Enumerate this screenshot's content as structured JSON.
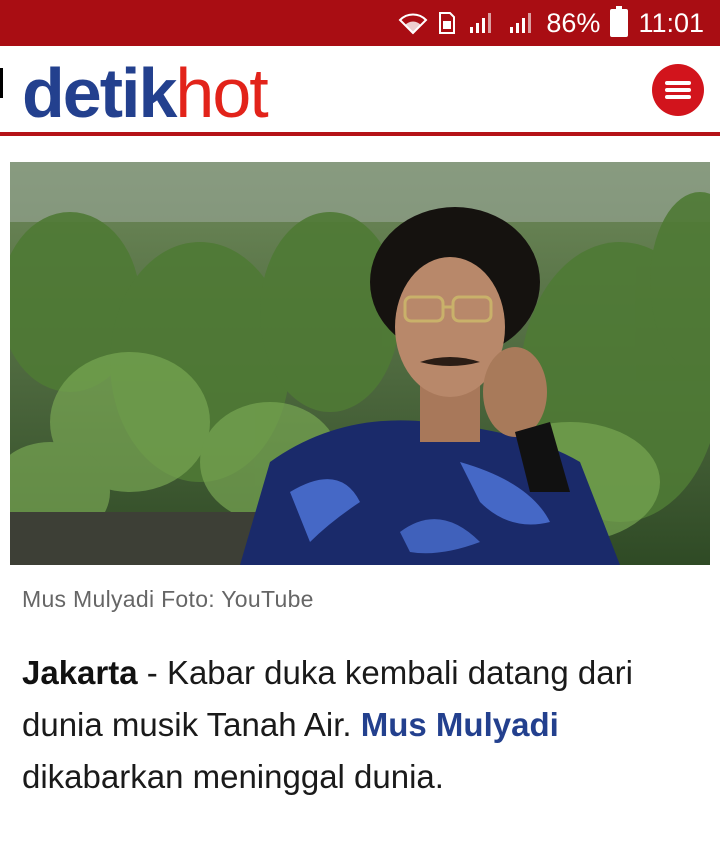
{
  "status_bar": {
    "battery": "86%",
    "time": "11:01",
    "icons": [
      "wifi-icon",
      "sim-icon",
      "signal-icon",
      "signal-icon",
      "battery-charging-icon"
    ]
  },
  "header": {
    "logo_part1": "detik",
    "logo_part2": "hot",
    "menu_icon": "hamburger-menu-icon"
  },
  "article": {
    "photo_caption": "Mus Mulyadi Foto: YouTube",
    "location": "Jakarta",
    "separator": " - ",
    "text1": "Kabar duka kembali datang dari dunia musik Tanah Air. ",
    "link_text": "Mus Mulyadi",
    "text2": " dikabarkan meninggal dunia."
  },
  "colors": {
    "status_bar": "#a90d13",
    "brand_blue": "#23408e",
    "brand_red": "#e2231a"
  }
}
